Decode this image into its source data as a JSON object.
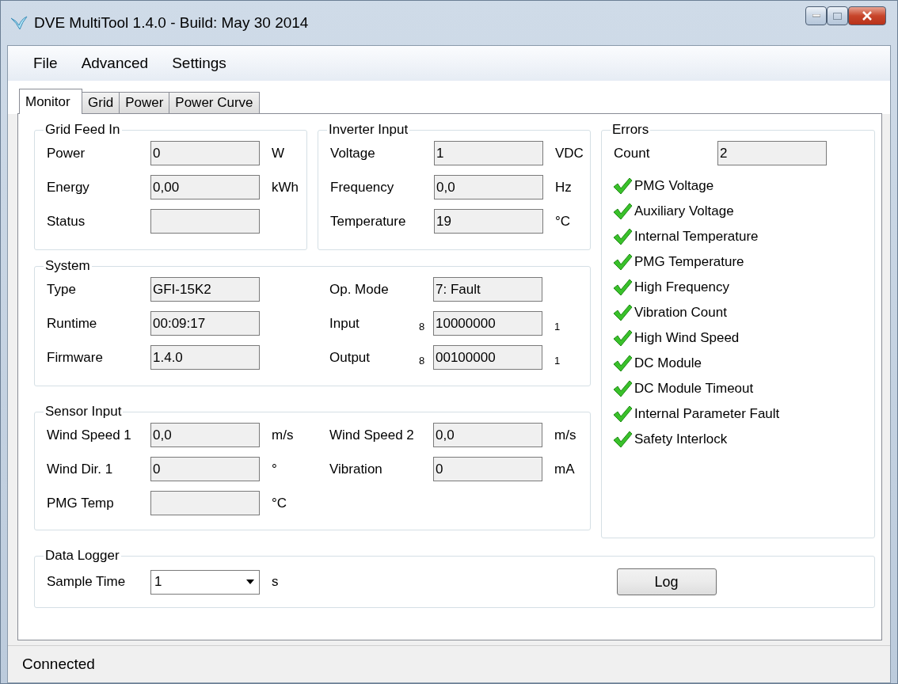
{
  "window": {
    "title": "DVE MultiTool 1.4.0 - Build: May 30 2014"
  },
  "menu": [
    "File",
    "Advanced",
    "Settings"
  ],
  "tabs": [
    {
      "label": "Monitor",
      "selected": true
    },
    {
      "label": "Grid",
      "selected": false
    },
    {
      "label": "Power",
      "selected": false
    },
    {
      "label": "Power Curve",
      "selected": false
    }
  ],
  "grid_feed_in": {
    "title": "Grid Feed In",
    "rows": [
      {
        "label": "Power",
        "value": "0",
        "unit": "W"
      },
      {
        "label": "Energy",
        "value": "0,00",
        "unit": "kWh"
      },
      {
        "label": "Status"
      }
    ]
  },
  "inverter_input": {
    "title": "Inverter Input",
    "rows": [
      {
        "label": "Voltage",
        "value": "1",
        "unit": "VDC"
      },
      {
        "label": "Frequency",
        "value": "0,0",
        "unit": "Hz"
      },
      {
        "label": "Temperature",
        "value": "19",
        "unit": "°C"
      }
    ]
  },
  "system": {
    "title": "System",
    "left": [
      {
        "label": "Type",
        "value": "GFI-15K2"
      },
      {
        "label": "Runtime",
        "value": "00:09:17"
      },
      {
        "label": "Firmware",
        "value": "1.4.0"
      }
    ],
    "right": [
      {
        "label": "Op. Mode",
        "value": "7: Fault"
      },
      {
        "label": "Input",
        "prefix": "8",
        "value": "10000000",
        "unit": "1"
      },
      {
        "label": "Output",
        "prefix": "8",
        "value": "00100000",
        "unit": "1"
      }
    ]
  },
  "sensor_input": {
    "title": "Sensor Input",
    "left": [
      {
        "label": "Wind Speed 1",
        "value": "0,0",
        "unit": "m/s"
      },
      {
        "label": "Wind Dir. 1",
        "value": "0",
        "unit": "°"
      },
      {
        "label": "PMG Temp",
        "unit": "°C"
      }
    ],
    "right": [
      {
        "label": "Wind Speed 2",
        "value": "0,0",
        "unit": "m/s"
      },
      {
        "label": "Vibration",
        "value": "0",
        "unit": "mA"
      }
    ]
  },
  "errors": {
    "title": "Errors",
    "count_label": "Count",
    "count": "2",
    "items": [
      {
        "label": "PMG Voltage",
        "ok": true
      },
      {
        "label": "Auxiliary Voltage",
        "ok": true
      },
      {
        "label": "Internal Temperature",
        "ok": true
      },
      {
        "label": "PMG Temperature",
        "ok": true
      },
      {
        "label": "High Frequency",
        "ok": true
      },
      {
        "label": "Vibration Count",
        "ok": true
      },
      {
        "label": "High Wind Speed",
        "ok": true
      },
      {
        "label": "DC Module",
        "ok": true
      },
      {
        "label": "DC Module Timeout",
        "ok": true
      },
      {
        "label": "Internal Parameter Fault",
        "ok": true
      },
      {
        "label": "Safety Interlock",
        "ok": true
      }
    ]
  },
  "data_logger": {
    "title": "Data Logger",
    "sample_label": "Sample Time",
    "sample_value": "1",
    "unit": "s",
    "button": "Log"
  },
  "status_bar": "Connected"
}
